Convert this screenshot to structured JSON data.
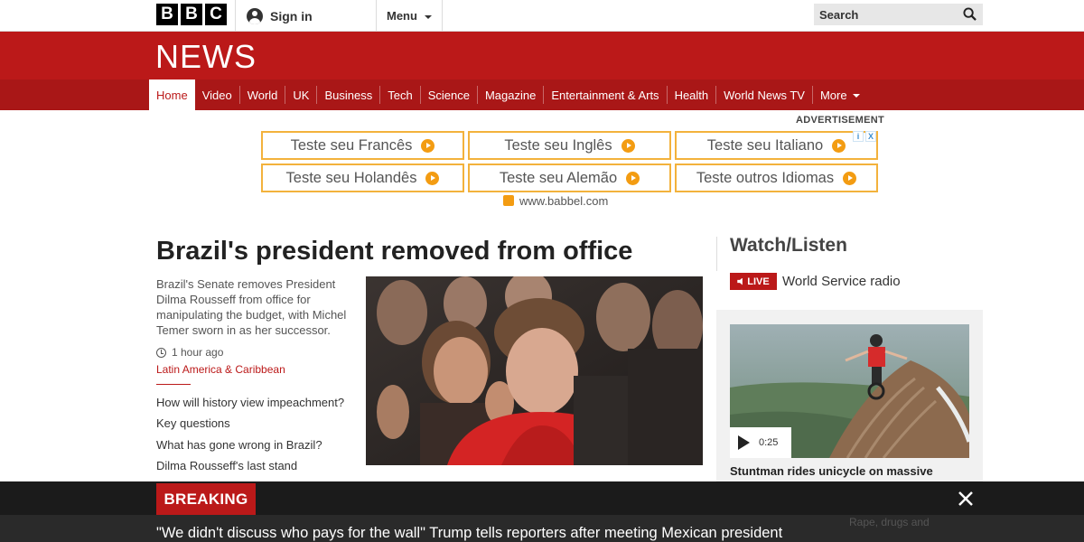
{
  "topbar": {
    "logo_letters": [
      "B",
      "B",
      "C"
    ],
    "signin_label": "Sign in",
    "menu_label": "Menu",
    "search_placeholder": "Search"
  },
  "banner": {
    "wordmark": "NEWS",
    "nav": [
      {
        "label": "Home",
        "active": true
      },
      {
        "label": "Video"
      },
      {
        "label": "World"
      },
      {
        "label": "UK"
      },
      {
        "label": "Business"
      },
      {
        "label": "Tech"
      },
      {
        "label": "Science"
      },
      {
        "label": "Magazine"
      },
      {
        "label": "Entertainment & Arts"
      },
      {
        "label": "Health"
      },
      {
        "label": "World News TV"
      },
      {
        "label": "More"
      }
    ],
    "brand_color": "#bb1919"
  },
  "ad": {
    "label": "ADVERTISEMENT",
    "buttons": [
      {
        "label": "Teste seu Francês"
      },
      {
        "label": "Teste seu Inglês"
      },
      {
        "label": "Teste seu Italiano"
      },
      {
        "label": "Teste seu Holandês"
      },
      {
        "label": "Teste seu Alemão"
      },
      {
        "label": "Teste outros Idiomas"
      }
    ],
    "adchoice_i": "i",
    "adchoice_x": "X",
    "sponsor_url": "www.babbel.com",
    "accent_color": "#f3b23c"
  },
  "story": {
    "headline": "Brazil's president removed from office",
    "summary": "Brazil's Senate removes President Dilma Rousseff from office for manipulating the budget, with Michel Temer sworn in as her successor.",
    "time": "1 hour ago",
    "section": "Latin America & Caribbean",
    "related": [
      "How will history view impeachment?",
      "Key questions",
      "What has gone wrong in Brazil?",
      "Dilma Rousseff's last stand"
    ]
  },
  "watch": {
    "title": "Watch/Listen",
    "live_label": "LIVE",
    "radio_label": "World Service radio",
    "video_duration": "0:25",
    "video_title": "Stuntman rides unicycle on massive"
  },
  "breaking": {
    "label": "BREAKING",
    "text": "\"We didn't discuss who pays for the wall\" Trump tells reporters after meeting Mexican president",
    "ghost_text": "Rape, drugs and"
  }
}
